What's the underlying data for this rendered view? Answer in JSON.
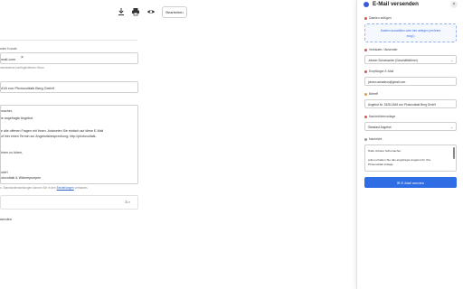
{
  "toolbar": {
    "edit_label": "Bearbeiten"
  },
  "form": {
    "customer_label": "nder Kunde",
    "customer_chip": "mail.com",
    "customer_hint": "mindestens kontingentiertes Hinzu",
    "subject_value": "418 von Photovoltaik Berg GmbH",
    "body_lines": [
      "macher,",
      "ie angefragte Angebot.",
      "e alle offenen Fragen mit Ihnen. Antworten Sie einfach auf diese E-Mail",
      "uf hier einen Termin zur Angebotsbesprechung: http://photovoltaik-",
      "hnen zu hören,",
      "mbH",
      "otovoltaik & Wärmepumpen"
    ],
    "footer_hint_prefix": "n. Standardeinstellungen können Sie in den ",
    "footer_hint_link": "Einstellungen",
    "footer_hint_suffix": " verfassen.",
    "pager_text": "3 >",
    "bottom_text": "senden"
  },
  "panel": {
    "title": "E-Mail versenden",
    "close_label": "×",
    "attach_label": "Dateien anfügen",
    "dropzone_line1": "Dateien auswählen oder hier ablegen (mehrere",
    "dropzone_line2": "mögl.)",
    "sender_label": "Verkäufer / Absender",
    "sender_value": "Johann Schumacher (Geschäftsführer)",
    "recipient_label": "Empfänger E-Mail",
    "recipient_value": "johann.amadeus@gmail.com",
    "subject_label": "Betreff",
    "subject_value": "Angebot Nr. 3328-1848 von Photovoltaik Berg GmbH",
    "template_label": "Nachrichtenvorlage",
    "template_value": "Standard Angebot",
    "message_label": "Nachricht",
    "message_line1": "Hallo Johann Schumacher,",
    "message_line2": "anbei erhalten Sie das angefragte Angebot für Ihre",
    "message_line3": "Photovoltaik-Anlage.",
    "send_label": "✉ E-Mail senden",
    "accent_color": "#2e6de3"
  }
}
